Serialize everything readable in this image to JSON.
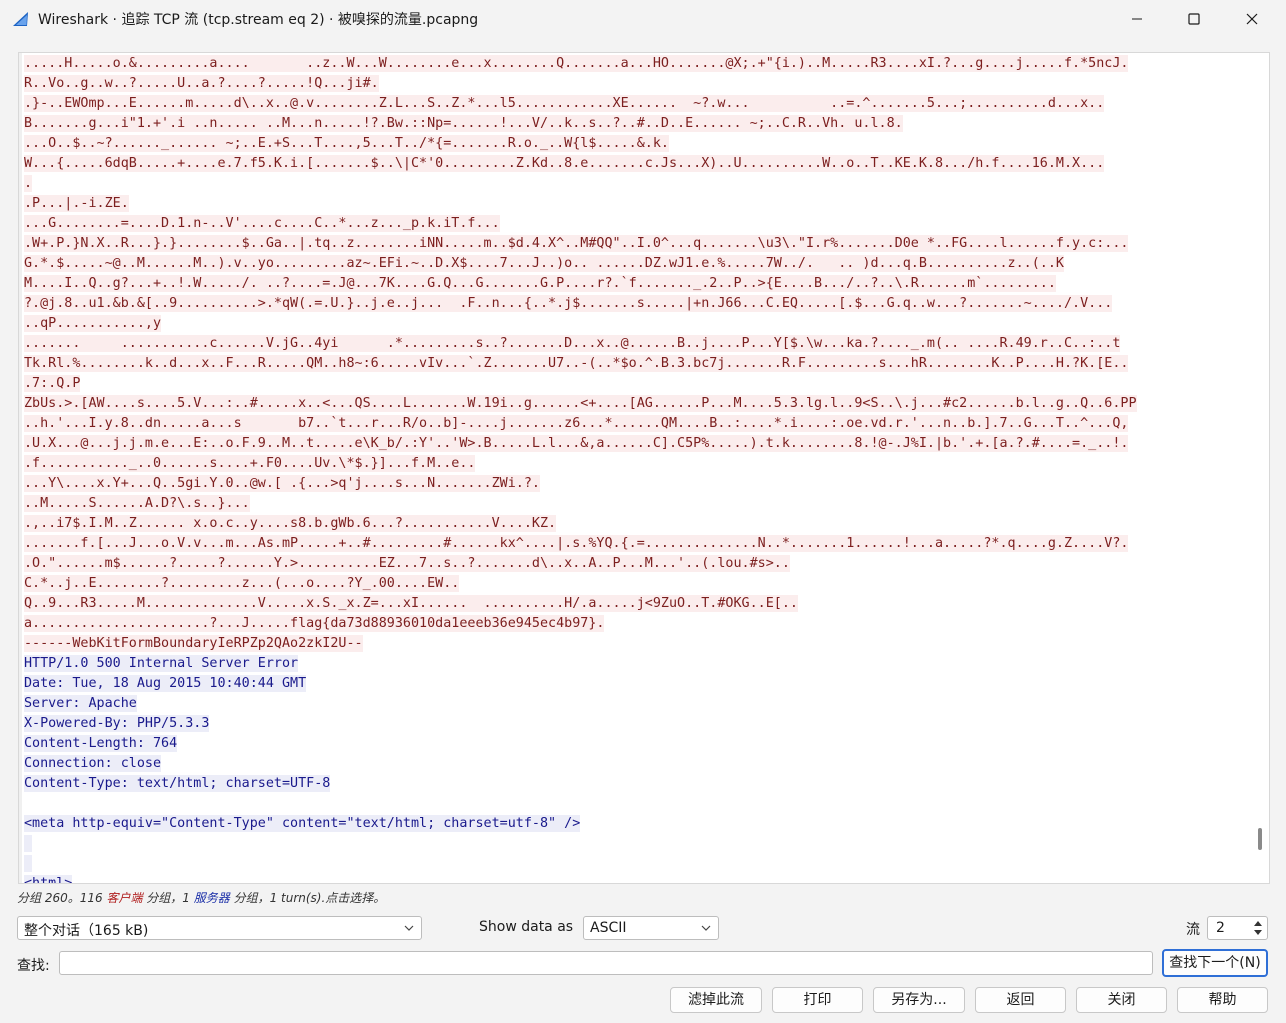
{
  "window": {
    "title": "Wireshark · 追踪 TCP 流 (tcp.stream eq 2) · 被嗅探的流量.pcapng"
  },
  "stream": {
    "client_lines": [
      ".....H.....o.&.........a....       ..z..W...W........e...x........Q.......a...HO.......@X;.+\"{i.)..M.....R3....xI.?...g....j.....f.*5ncJ.",
      "R..Vo..g..w..?.....U..a.?....?.....!Q...ji#.",
      ".}-..EWOmp...E......m.....d\\..x..@.v........Z.L...S..Z.*...l5............XE......  ~?.w...          ..=.^.......5...;..........d...x..",
      "B.......g...i\"1.+'.i ..n..... ..M...n.....!?.Bw.::Np=......!...V/..k..s..?..#..D..E...... ~;..C.R..Vh. u.l.8.",
      "...O..$..~?......_...... ~;..E.+S...T....,5...T../*{=.......R.o._..W{l$.....&.k.",
      "W...{.....6dqB.....+....e.7.f5.K.i.[.......$..\\|C*'0.........Z.Kd..8.e.......c.Js...X)..U..........W..o..T..KE.K.8.../h.f....16.M.X...",
      ".",
      ".P...|.-i.ZE.",
      "...G........=....D.1.n-..V'....c....C..*...z..._p.k.iT.f...",
      ".W+.P.}N.X..R...}.}........$..Ga..|.tq..z........iNN.....m..$d.4.X^..M#QQ\"..I.0^...q.......\\u3\\.\"I.r%.......D0e *..FG....l......f.y.c:...",
      "G.*.$.....~@..M......M..).v..yo.........az~.EFi.~..D.X$....7...J..)o.. ......DZ.wJ1.e.%.....7W../.   .. )d...q.B..........z..(..K",
      "M....I..Q..g?...+..!.W...../. ..?....=.J@...7K....G.Q...G.......G.P....r?.`f......._.2..P..>{E....B.../..?..\\.R......m`.........",
      "?.@j.8..u1.&b.&[..9..........>.*qW(.=.U.}..j.e..j...  .F..n...{..*.j$.......s.....|+n.J66...C.EQ.....[.$...G.q..w...?.......~..../.V...",
      "..qP...........,y",
      ".......     ...........c......V.jG..4yi      .*.........s..?.......D...x..@......B..j....P...Y[$.\\w...ka.?...._.m(.. ....R.49.r..C..:..t",
      "Tk.Rl.%........k..d...x..F...R.....QM..h8~:6.....vIv...`.Z.......U7..-(..*$o.^.B.3.bc7j.......R.F.........s...hR........K..P....H.?K.[E..",
      ".7:.Q.P",
      "ZbUs.>.[AW....s....5.V...:..#.....x..<...QS....L.......W.19i..g......<+....[AG......P...M....5.3.lg.l..9<S..\\.j...#c2......b.l..g..Q..6.PP",
      "..h.'...I.y.8..dn.....a...s       b7..`t...r...R/o..b]-....j.......z6...*......QM....B..:....*.i....:.oe.vd.r.'...n..b.].7..G...T..^...Q,",
      ".U.X...@...j.j.m.e...E:..o.F.9..M..t.....e\\K_b/.:Y'..'W>.B.....L.l...&,a......C].C5P%.....).t.k........8.!@-.J%I.|b.'.+.[a.?.#....=._..!.",
      ".f..........._..0......s....+.F0....Uv.\\*$.}]...f.M..e..",
      "...Y\\....x.Y+...Q..5gi.Y.0..@w.[ .{...>q'j....s...N.......ZWi.?.",
      "..M.....S......A.D?\\.s..}...",
      ".,..i7$.I.M..Z...... x.o.c..y....s8.b.gWb.6...?...........V....KZ.",
      ".......f.[...J...o.V.v...m...As.mP.....+..#.........#......kx^....|.s.%YQ.{.=..............N..*.......1......!...a.....?*.q....g.Z....V?.",
      ".O.\"......m$......?.....?......Y.>..........EZ...7..s..?.......d\\..x..A..P...M...'..(.lou.#s>..",
      "C.*..j..E........?.........z...(...o....?Y_.00....EW..",
      "Q..9...R3.....M..............V.....x.S._x.Z=...xI......  ..........H/.a.....j<9ZuO..T.#OKG..E[..",
      "a......................?...J.....flag{da73d88936010da1eeeb36e945ec4b97}.",
      "------WebKitFormBoundaryIeRPZp2QAo2zkI2U--"
    ],
    "server_lines": [
      "HTTP/1.0 500 Internal Server Error",
      "Date: Tue, 18 Aug 2015 10:40:44 GMT",
      "Server: Apache",
      "X-Powered-By: PHP/5.3.3",
      "Content-Length: 764",
      "Connection: close",
      "Content-Type: text/html; charset=UTF-8",
      "",
      "<meta http-equiv=\"Content-Type\" content=\"text/html; charset=utf-8\" />",
      " ",
      " ",
      "<html>"
    ]
  },
  "status": {
    "prefix": "分组 260。116 ",
    "client_word": "客户端",
    "middle": " 分组，1 ",
    "server_word": "服务器",
    "suffix": " 分组，1 turn(s).点击选择。"
  },
  "controls": {
    "conversation_select": "整个对话（165 kB)",
    "show_data_label": "Show data as",
    "show_data_value": "ASCII",
    "stream_label": "流",
    "stream_value": "2",
    "find_label": "查找:",
    "find_value": "",
    "find_next_label": "查找下一个(N)"
  },
  "buttons": {
    "filter_out": "滤掉此流",
    "print": "打印",
    "save_as": "另存为...",
    "back": "返回",
    "close": "关闭",
    "help": "帮助"
  },
  "colors": {
    "client_bg": "#fbeded",
    "client_text": "#7c1e1e",
    "server_bg": "#ecedf8",
    "server_text": "#1a1a8c",
    "accent": "#2f6fd6"
  },
  "icons": {
    "app": "wireshark-fin-icon",
    "minimize": "minimize-icon",
    "maximize": "maximize-icon",
    "close": "close-icon"
  }
}
